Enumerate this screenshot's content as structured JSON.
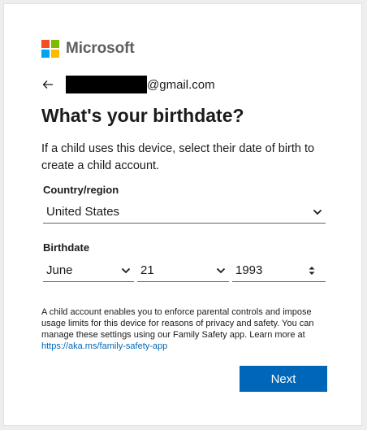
{
  "brand": {
    "name": "Microsoft",
    "colors": [
      "#f25022",
      "#7fba00",
      "#00a4ef",
      "#ffb900"
    ]
  },
  "identity": {
    "email_suffix": "@gmail.com"
  },
  "page": {
    "title": "What's your birthdate?",
    "description": "If a child uses this device, select their date of birth to create a child account."
  },
  "country": {
    "label": "Country/region",
    "value": "United States"
  },
  "birthdate": {
    "label": "Birthdate",
    "month": "June",
    "day": "21",
    "year": "1993"
  },
  "note": {
    "text": "A child account enables you to enforce parental controls and impose usage limits for this device for reasons of privacy and safety. You can manage these settings using our Family Safety app. Learn more at ",
    "link": "https://aka.ms/family-safety-app"
  },
  "actions": {
    "next_label": "Next"
  },
  "colors": {
    "accent": "#0067b8",
    "text": "#1b1b1b",
    "background": "#ffffff"
  }
}
